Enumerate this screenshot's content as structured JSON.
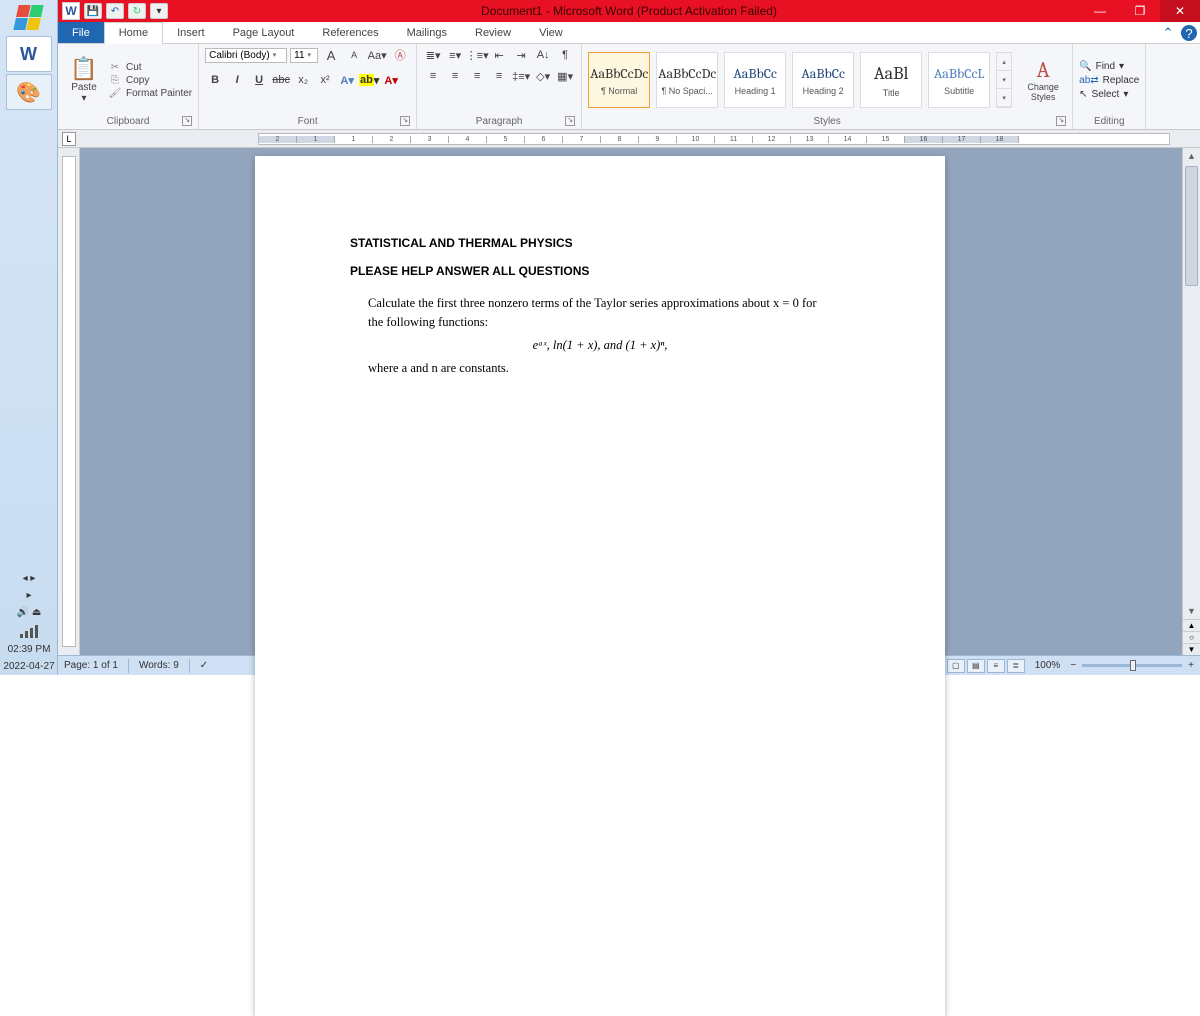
{
  "taskbar": {
    "time": "02:39 PM",
    "date": "2022-04-27"
  },
  "titlebar": {
    "title": "Document1 - Microsoft Word (Product Activation Failed)"
  },
  "tabs": {
    "file": "File",
    "home": "Home",
    "insert": "Insert",
    "page_layout": "Page Layout",
    "references": "References",
    "mailings": "Mailings",
    "review": "Review",
    "view": "View"
  },
  "ribbon": {
    "clipboard": {
      "paste": "Paste",
      "cut": "Cut",
      "copy": "Copy",
      "format_painter": "Format Painter",
      "label": "Clipboard"
    },
    "font": {
      "name": "Calibri (Body)",
      "size": "11",
      "label": "Font"
    },
    "paragraph": {
      "label": "Paragraph"
    },
    "styles": {
      "label": "Styles",
      "items": [
        {
          "sample": "AaBbCcDc",
          "name": "¶ Normal"
        },
        {
          "sample": "AaBbCcDc",
          "name": "¶ No Spaci..."
        },
        {
          "sample": "AaBbCc",
          "name": "Heading 1"
        },
        {
          "sample": "AaBbCc",
          "name": "Heading 2"
        },
        {
          "sample": "AaBl",
          "name": "Title"
        },
        {
          "sample": "AaBbCcL",
          "name": "Subtitle"
        }
      ],
      "change": "Change Styles"
    },
    "editing": {
      "find": "Find",
      "replace": "Replace",
      "select": "Select",
      "label": "Editing"
    }
  },
  "document": {
    "line1": "STATISTICAL AND THERMAL PHYSICS",
    "line2": "PLEASE HELP ANSWER ALL QUESTIONS",
    "body1": "Calculate the first three nonzero terms of the Taylor series approximations about x = 0 for the following functions:",
    "formula": "eᵃˣ, ln(1 + x), and (1 + x)ⁿ,",
    "body2": "where a and n are constants."
  },
  "statusbar": {
    "page": "Page: 1 of 1",
    "words": "Words: 9",
    "zoom": "100%"
  }
}
